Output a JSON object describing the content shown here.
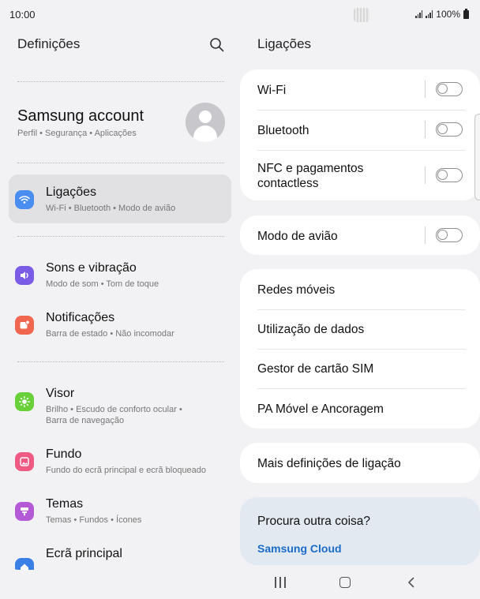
{
  "status_bar": {
    "time": "10:00",
    "battery": "100%",
    "icons": [
      "camera-cutout-icon",
      "signal-icon",
      "signal-icon",
      "battery-icon"
    ]
  },
  "left_pane": {
    "title": "Definições",
    "search_icon": "search-icon",
    "account": {
      "name": "Samsung account",
      "subtitle": "Perfil  •  Segurança  •  Aplicações",
      "avatar_icon": "person-icon"
    },
    "items": [
      {
        "title": "Ligações",
        "subtitle": "Wi-Fi  •  Bluetooth  •  Modo de avião",
        "icon": "wifi-icon",
        "color": "#4a8df0",
        "selected": true
      },
      {
        "title": "Sons e vibração",
        "subtitle": "Modo de som  •  Tom de toque",
        "icon": "volume-icon",
        "color": "#7b5ce6"
      },
      {
        "title": "Notificações",
        "subtitle": "Barra de estado  •  Não incomodar",
        "icon": "notification-icon",
        "color": "#f0674f"
      },
      {
        "title": "Visor",
        "subtitle": "Brilho  •  Escudo de conforto ocular  •\nBarra de navegação",
        "icon": "sun-icon",
        "color": "#6ad03a"
      },
      {
        "title": "Fundo",
        "subtitle": "Fundo do ecrã principal e ecrã bloqueado",
        "icon": "image-icon",
        "color": "#ef5a82"
      },
      {
        "title": "Temas",
        "subtitle": "Temas  •  Fundos  •  Ícones",
        "icon": "brush-icon",
        "color": "#b55ad6"
      },
      {
        "title": "Ecrã principal",
        "subtitle": "",
        "icon": "home-icon",
        "color": "#3a7fe5"
      }
    ]
  },
  "right_pane": {
    "title": "Ligações",
    "group1": [
      {
        "label": "Wi-Fi",
        "toggle": "off"
      },
      {
        "label": "Bluetooth",
        "toggle": "off"
      },
      {
        "label": "NFC e pagamentos\ncontactless",
        "toggle": "off"
      }
    ],
    "group2": [
      {
        "label": "Modo de avião",
        "toggle": "off"
      }
    ],
    "group3": [
      {
        "label": "Redes móveis"
      },
      {
        "label": "Utilização de dados"
      },
      {
        "label": "Gestor de cartão SIM"
      },
      {
        "label": "PA Móvel e Ancoragem"
      }
    ],
    "group4": [
      {
        "label": "Mais definições de ligação"
      }
    ],
    "looking_for": {
      "title": "Procura outra coisa?",
      "link": "Samsung Cloud"
    }
  },
  "nav_bar": {
    "icons": [
      "recent-apps-icon",
      "home-icon",
      "back-icon"
    ]
  },
  "colors": {
    "background": "#f2f2f4",
    "selected_item": "#e1e1e4",
    "link": "#1a6cc8",
    "suggest_card": "#e3e9f1"
  }
}
